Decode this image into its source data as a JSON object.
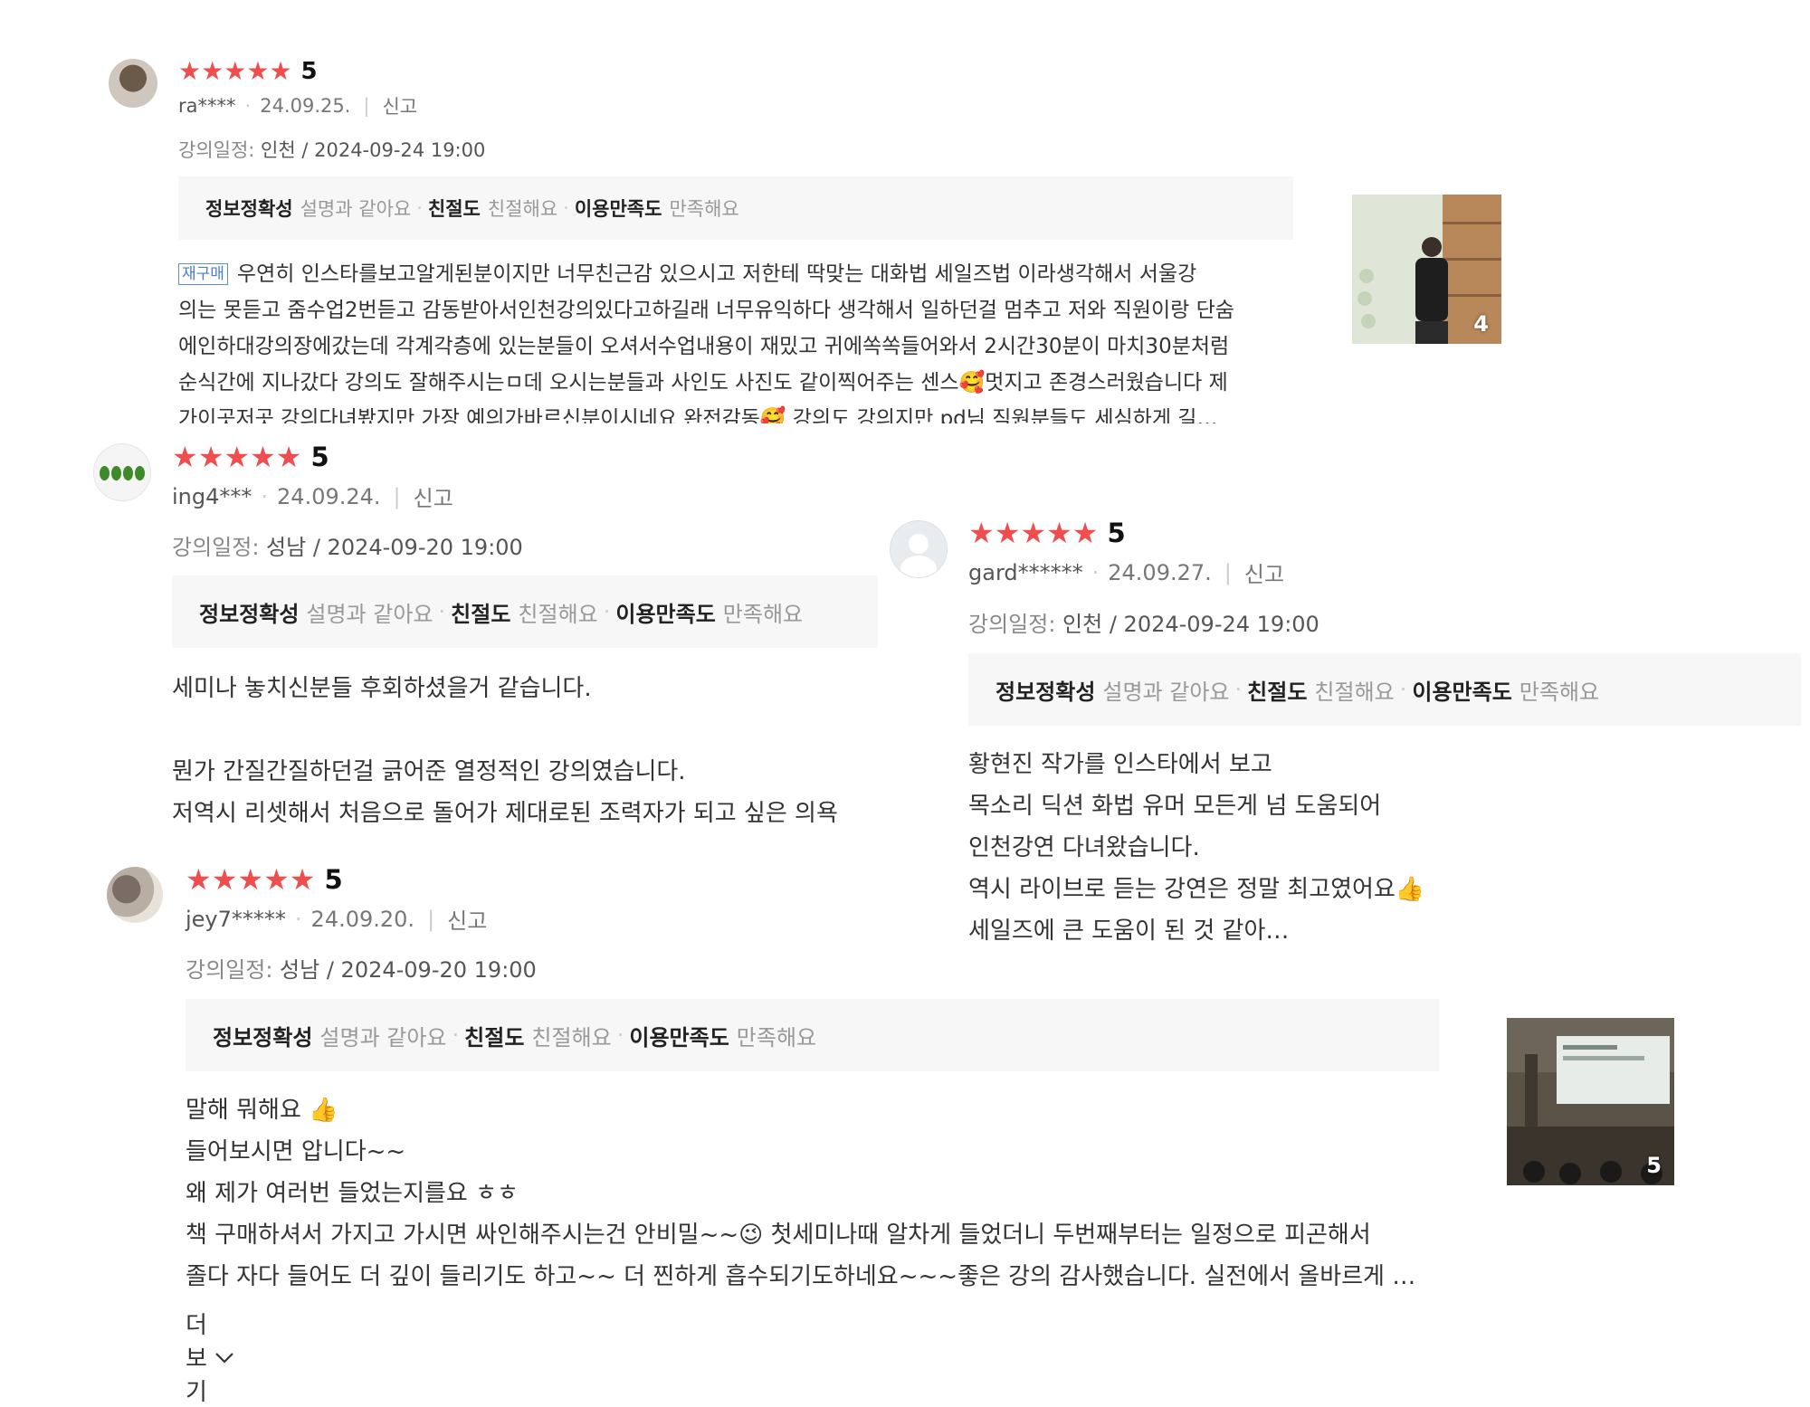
{
  "reviews": [
    {
      "user": "ra****",
      "date": "24.09.25.",
      "score": "5",
      "report": "신고",
      "schedule_label": "강의일정:",
      "schedule": "인천 / 2024-09-24 19:00",
      "tags": [
        {
          "k": "정보정확성",
          "v": "설명과 같아요"
        },
        {
          "k": "친절도",
          "v": "친절해요"
        },
        {
          "k": "이용만족도",
          "v": "만족해요"
        }
      ],
      "badge": "재구매",
      "lines": [
        "우연히  인스타를보고알게된분이지만 너무친근감 있으시고  저한테 딱맞는 대화법 세일즈법 이라생각해서 서울강",
        "의는 못듣고 줌수업2번듣고 감동받아서인천강의있다고하길래 너무유익하다 생각해서 일하던걸 멈추고 저와 직원이랑 단숨",
        "에인하대강의장에갔는데 각계각층에 있는분들이 오셔서수업내용이 재밌고 귀에쏙쏙들어와서 2시간30분이 마치30분처럼",
        "순식간에 지나갔다 강의도 잘해주시는ㅁ데 오시는분들과 사인도 사진도 같이찍어주는 센스🥰멋지고 존경스러웠습니다 제",
        "가이곳저곳  강의다녀봤지만 가장 예의가바르신분이시네요 완전감동🥰  강의도 강의지만 pd님 직원분들도 세심하게 길…"
      ],
      "photo_count": "4"
    },
    {
      "user": "ing4***",
      "date": "24.09.24.",
      "score": "5",
      "report": "신고",
      "schedule_label": "강의일정:",
      "schedule": "성남 / 2024-09-20 19:00",
      "tags": [
        {
          "k": "정보정확성",
          "v": "설명과 같아요"
        },
        {
          "k": "친절도",
          "v": "친절해요"
        },
        {
          "k": "이용만족도",
          "v": "만족해요"
        }
      ],
      "lines": [
        "세미나 놓치신분들 후회하셨을거 같습니다.",
        "",
        "뭔가 간질간질하던걸 긁어준 열정적인 강의였습니다.",
        "저역시 리셋해서 처음으로 돌어가 제대로된 조력자가 되고 싶은 의욕"
      ]
    },
    {
      "user": "gard******",
      "date": "24.09.27.",
      "score": "5",
      "report": "신고",
      "schedule_label": "강의일정:",
      "schedule": "인천 / 2024-09-24 19:00",
      "tags": [
        {
          "k": "정보정확성",
          "v": "설명과 같아요"
        },
        {
          "k": "친절도",
          "v": "친절해요"
        },
        {
          "k": "이용만족도",
          "v": "만족해요"
        }
      ],
      "lines": [
        "황현진 작가를 인스타에서 보고",
        "목소리 딕션 화법 유머 모든게 넘 도움되어",
        "인천강연 다녀왔습니다.",
        "역시 라이브로 듣는 강연은 정말 최고였어요👍",
        "세일즈에 큰 도움이 된 것 같아…"
      ]
    },
    {
      "user": "jey7*****",
      "date": "24.09.20.",
      "score": "5",
      "report": "신고",
      "schedule_label": "강의일정:",
      "schedule": "성남 / 2024-09-20 19:00",
      "tags": [
        {
          "k": "정보정확성",
          "v": "설명과 같아요"
        },
        {
          "k": "친절도",
          "v": "친절해요"
        },
        {
          "k": "이용만족도",
          "v": "만족해요"
        }
      ],
      "lines": [
        "말해 뭐해요 👍",
        "들어보시면 압니다~~",
        "왜 제가 여러번 들었는지를요 ㅎㅎ",
        "책 구매하셔서 가지고 가시면 싸인해주시는건 안비밀~~😉 첫세미나때 알차게 들었더니 두번째부터는 일정으로 피곤해서",
        "졸다 자다 들어도 더 깊이 들리기도 하고~~ 더 찐하게 흡수되기도하네요~~~좋은 강의 감사했습니다. 실전에서 올바르게 …"
      ],
      "more_label": "더보기",
      "photo_count": "5"
    }
  ],
  "icons": {
    "star": "star-icon",
    "chevron": "chevron-down-icon"
  },
  "colors": {
    "star": "#f04e4e",
    "badge": "#4a7dc9"
  }
}
